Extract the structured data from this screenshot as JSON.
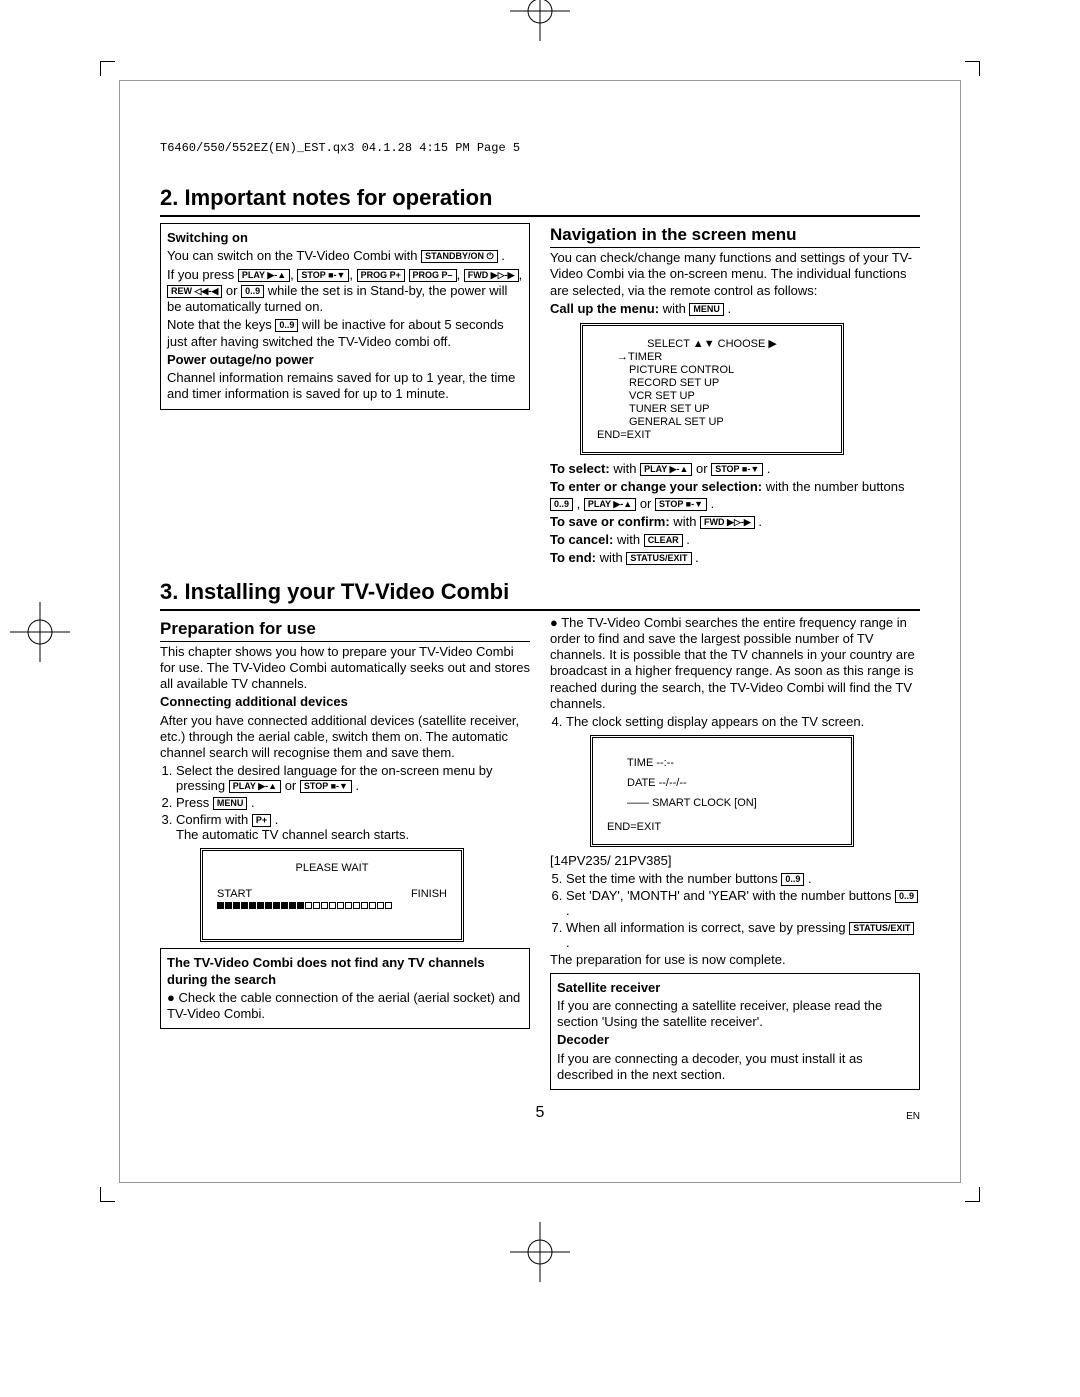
{
  "header": "T6460/550/552EZ(EN)_EST.qx3  04.1.28  4:15 PM  Page 5",
  "pageNumber": "5",
  "langCode": "EN",
  "section1": {
    "title": "2. Important notes for operation",
    "left": {
      "switchingOn": "Switching on",
      "switchingOnText1": "You can switch on the TV-Video Combi with",
      "ifYouPress": "If you press ",
      "standbyText": " while the set is in Stand-by, the power will be automatically turned on.",
      "noteKeys1": "Note that the keys ",
      "noteKeys2": " will be inactive for about 5 seconds just after having switched the TV-Video combi off.",
      "powerOutage": "Power outage/no power",
      "powerText": "Channel information remains saved for up to 1 year, the time and timer information is saved for up to 1 minute."
    },
    "right": {
      "navTitle": "Navigation in the screen menu",
      "navIntro": "You can check/change many functions and settings of your TV-Video Combi via the on-screen menu. The individual functions are selected, via the remote control as follows:",
      "callUp": "Call up the menu:",
      "withText": " with ",
      "osd": {
        "select": "SELECT ▲▼ CHOOSE ▶",
        "timer": "→TIMER",
        "pic": "PICTURE CONTROL",
        "rec": "RECORD SET UP",
        "vcr": "VCR SET UP",
        "tuner": "TUNER SET UP",
        "gen": "GENERAL SET UP",
        "end": "END=EXIT"
      },
      "toSelect": "To select:",
      "orText": " or ",
      "toEnter": "To enter or change your selection:",
      "withThe": " with the number buttons ",
      "toSave": "To save or confirm:",
      "toCancel": "To cancel:",
      "toEnd": "To end:"
    }
  },
  "section2": {
    "title": "3. Installing your TV-Video Combi",
    "left": {
      "prepTitle": "Preparation for use",
      "prepIntro": "This chapter shows you how to prepare your TV-Video Combi for use. The TV-Video Combi automatically seeks out and stores all available TV channels.",
      "connecting": "Connecting additional devices",
      "connectingText": "After you have connected additional devices (satellite receiver, etc.) through the aerial cable, switch them on. The automatic channel search will recognise them and save them.",
      "step1a": "Select the desired language for the on-screen menu by pressing ",
      "step2a": "Press ",
      "step3a": "Confirm with ",
      "step3b": "The automatic TV channel search starts.",
      "osdWait": "PLEASE WAIT",
      "osdStart": "START",
      "osdFinish": "FINISH",
      "noFind": "The TV-Video Combi does not find any TV channels during the search",
      "noFindBullet": "Check the cable connection of the aerial (aerial socket) and TV-Video Combi."
    },
    "right": {
      "bullet": "The TV-Video Combi searches the entire frequency range in order to find and save the largest possible number of TV channels. It is possible that the TV channels in your country are broadcast in a higher frequency range. As soon as this range is reached during the search, the TV-Video Combi will find the TV channels.",
      "step4a": "The clock setting display appears on the TV screen.",
      "osdTime": "TIME  --:--",
      "osdDate": "DATE  --/--/--",
      "osdSmart": "SMART CLOCK [ON]",
      "osdEnd": "END=EXIT",
      "model": "[14PV235/ 21PV385]",
      "step5": "Set the time with the number buttons ",
      "step6": "Set 'DAY', 'MONTH' and 'YEAR' with the number buttons ",
      "step7a": "When all information is correct, save by pressing ",
      "complete": "The preparation for use is now complete.",
      "sat": "Satellite receiver",
      "satText": "If you are connecting a satellite receiver, please read the section 'Using the satellite receiver'.",
      "decoder": "Decoder",
      "decoderText": "If you are connecting a decoder, you must install it as described in the next section."
    }
  },
  "buttons": {
    "standby": "STANDBY/ON ⏻",
    "playUp": "PLAY ▶-▲",
    "stopDn": "STOP ■-▼",
    "progP": "PROG P+",
    "progM": "PROG P–",
    "fwd": "FWD ▶▷-▶",
    "rew": "REW ◁◀-◀",
    "num": "0..9",
    "menu": "MENU",
    "clear": "CLEAR",
    "status": "STATUS/EXIT",
    "pplus": "P+"
  }
}
